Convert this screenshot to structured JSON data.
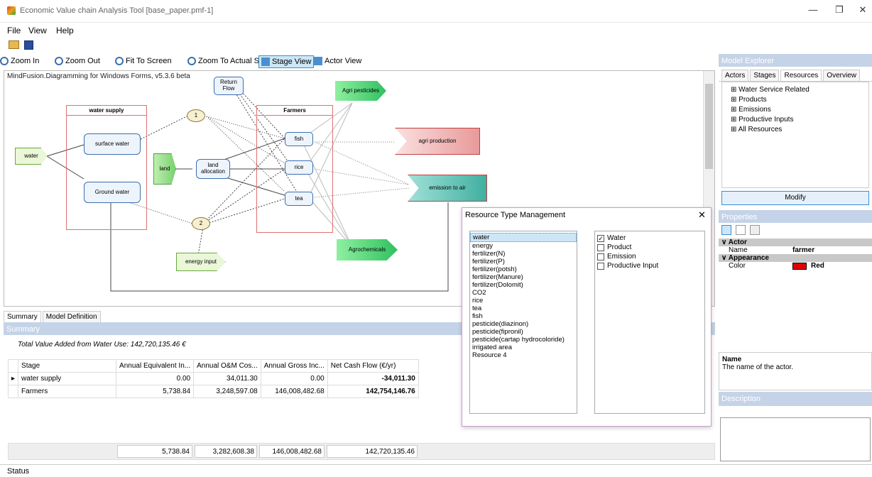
{
  "window": {
    "title": "Economic Value chain Analysis Tool [base_paper.pmf-1]",
    "minimize": "—",
    "restore": "❐",
    "close": "✕"
  },
  "menu": {
    "items": [
      "File",
      "View",
      "Help"
    ]
  },
  "zoombar": {
    "zoom_in": "Zoom In",
    "zoom_out": "Zoom Out",
    "fit": "Fit To Screen",
    "actual": "Zoom To Actual Size",
    "stage_view": "Stage View",
    "actor_view": "Actor View"
  },
  "diagram": {
    "header": "MindFusion.Diagramming for Windows Forms, v5.3.6 beta",
    "nodes": {
      "return_flow": "Return Flow",
      "water_supply": "water supply",
      "farmers": "Farmers",
      "agri_pesticides": "Agri pesticides",
      "water": "water",
      "surface_water": "surface water",
      "ground_water": "Ground water",
      "land": "land",
      "land_allocation": "land allocation",
      "fish": "fish",
      "rice": "rice",
      "tea": "tea",
      "agri_production": "agri production",
      "emission_to_air": "emission to air",
      "agrochemicals": "Agrochemicals",
      "energy_input": "energy input",
      "junction1": "1",
      "junction2": "2"
    }
  },
  "explorer": {
    "title": "Model Explorer",
    "tabs": [
      "Actors",
      "Stages",
      "Resources",
      "Overview"
    ],
    "active_tab": "Resources",
    "tree": [
      "Water Service Related",
      "Products",
      "Emissions",
      "Productive Inputs",
      "All Resources"
    ],
    "modify_button": "Modify"
  },
  "properties": {
    "title": "Properties",
    "category_actor": "Actor",
    "name_label": "Name",
    "name_value": "farmer",
    "category_appearance": "Appearance",
    "color_label": "Color",
    "color_value": "Red",
    "color_swatch": "#e00000",
    "help_title": "Name",
    "help_text": "The name of the actor.",
    "description_title": "Description"
  },
  "summary": {
    "tabs": [
      "Summary",
      "Model Definition"
    ],
    "header": "Summary",
    "total_text": "Total Value Added from Water Use: 142,720,135.46 €",
    "columns": [
      "Stage",
      "Annual Equivalent In...",
      "Annual O&M Cos...",
      "Annual Gross Inc...",
      "Net Cash Flow (€/yr)"
    ],
    "rows": [
      [
        "water supply",
        "0.00",
        "34,011.30",
        "0.00",
        "-34,011.30"
      ],
      [
        "Farmers",
        "5,738.84",
        "3,248,597.08",
        "146,008,482.68",
        "142,754,146.76"
      ]
    ],
    "totals": [
      "5,738.84",
      "3,282,608.38",
      "146,008,482.68",
      "142,720,135.46"
    ]
  },
  "dialog": {
    "title": "Resource Type Management",
    "close": "✕",
    "resources": [
      "water",
      "energy",
      "fertilizer(N)",
      "fertilizer(P)",
      "fertilizer(potsh)",
      "fertilizer(Manure)",
      "fertilizer(Dolomit)",
      "CO2",
      "rice",
      "tea",
      "fish",
      "pesticide(diazinon)",
      "pesticide(fipronil)",
      "pesticide(cartap hydrocoloride)",
      "irrigated area",
      "Resource 4"
    ],
    "types": [
      {
        "label": "Water",
        "checked": true
      },
      {
        "label": "Product",
        "checked": false
      },
      {
        "label": "Emission",
        "checked": false
      },
      {
        "label": "Productive Input",
        "checked": false
      }
    ]
  },
  "status": {
    "text": "Status"
  }
}
